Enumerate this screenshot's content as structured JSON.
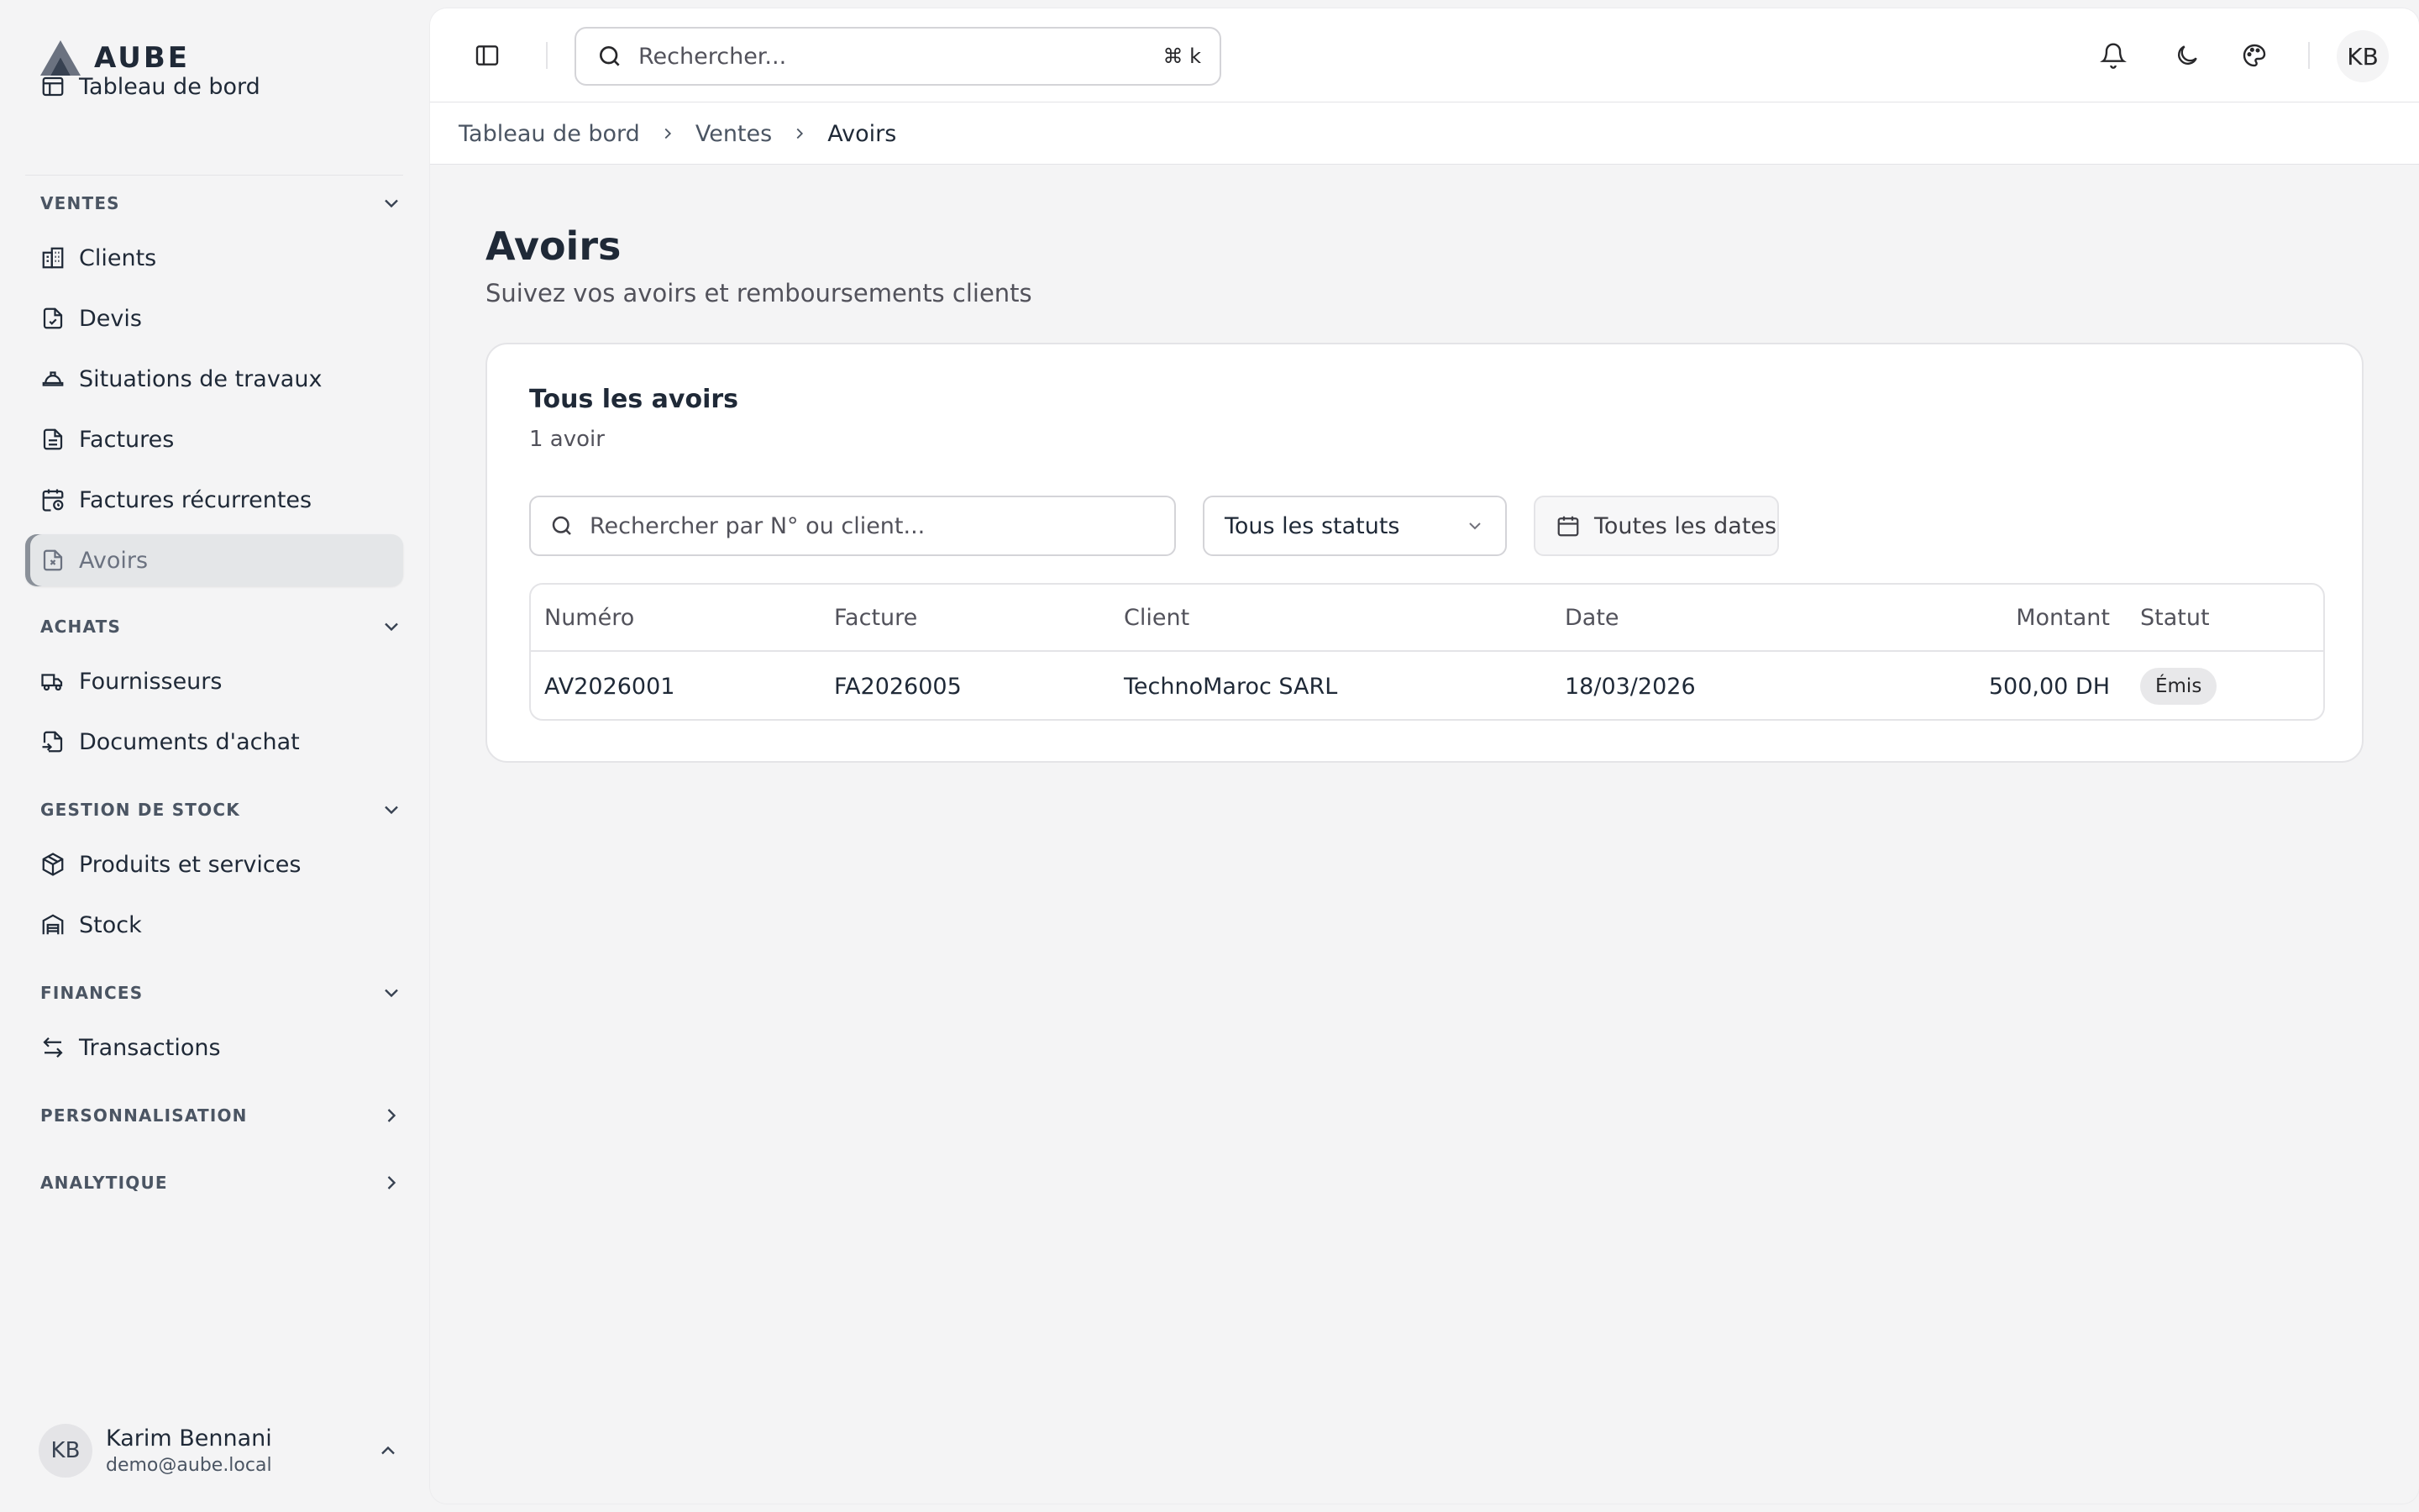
{
  "brand": {
    "name": "AUBE"
  },
  "sidebar": {
    "dashboard_label": "Tableau de bord",
    "sections": {
      "ventes": {
        "title": "VENTES",
        "items": [
          "Clients",
          "Devis",
          "Situations de travaux",
          "Factures",
          "Factures récurrentes",
          "Avoirs"
        ]
      },
      "achats": {
        "title": "ACHATS",
        "items": [
          "Fournisseurs",
          "Documents d'achat"
        ]
      },
      "stock": {
        "title": "GESTION DE STOCK",
        "items": [
          "Produits et services",
          "Stock"
        ]
      },
      "finances": {
        "title": "FINANCES",
        "items": [
          "Transactions"
        ]
      },
      "perso": {
        "title": "PERSONNALISATION"
      },
      "analytique": {
        "title": "ANALYTIQUE"
      }
    },
    "active_item": "Avoirs"
  },
  "user": {
    "initials": "KB",
    "name": "Karim Bennani",
    "email": "demo@aube.local"
  },
  "topbar": {
    "search_placeholder": "Rechercher...",
    "shortcut": "⌘ k",
    "avatar_initials": "KB"
  },
  "breadcrumb": [
    "Tableau de bord",
    "Ventes",
    "Avoirs"
  ],
  "page": {
    "title": "Avoirs",
    "subtitle": "Suivez vos avoirs et remboursements clients"
  },
  "card": {
    "title": "Tous les avoirs",
    "count": "1 avoir",
    "search_placeholder": "Rechercher par N° ou client...",
    "status_filter": "Tous les statuts",
    "date_filter": "Toutes les dates"
  },
  "table": {
    "columns": [
      "Numéro",
      "Facture",
      "Client",
      "Date",
      "Montant",
      "Statut"
    ],
    "rows": [
      {
        "numero": "AV2026001",
        "facture": "FA2026005",
        "client": "TechnoMaroc SARL",
        "date": "18/03/2026",
        "montant": "500,00 DH",
        "statut": "Émis"
      }
    ]
  },
  "colors": {
    "text": "#1f2937",
    "muted": "#52525b",
    "border": "#e4e4e7",
    "brand": "#4b5563"
  }
}
